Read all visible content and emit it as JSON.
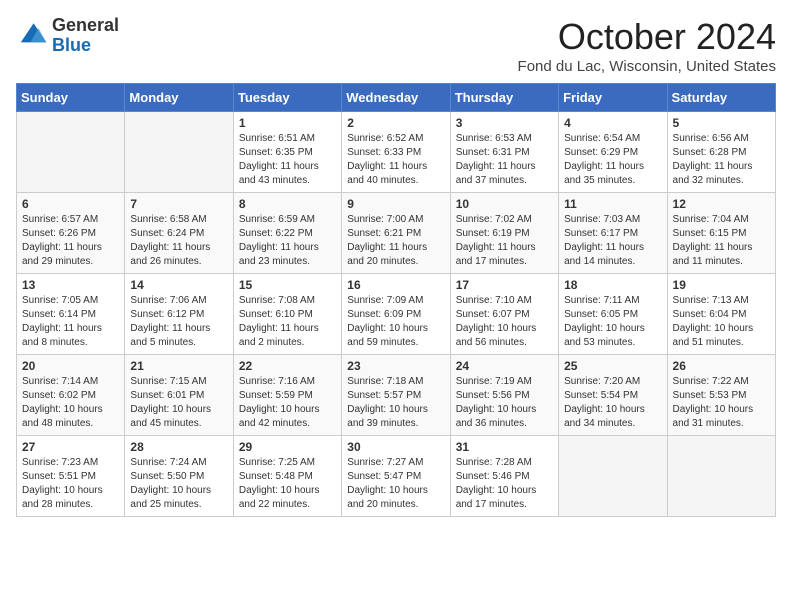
{
  "header": {
    "logo_line1": "General",
    "logo_line2": "Blue",
    "title": "October 2024",
    "subtitle": "Fond du Lac, Wisconsin, United States"
  },
  "columns": [
    "Sunday",
    "Monday",
    "Tuesday",
    "Wednesday",
    "Thursday",
    "Friday",
    "Saturday"
  ],
  "weeks": [
    [
      {
        "day": "",
        "info": ""
      },
      {
        "day": "",
        "info": ""
      },
      {
        "day": "1",
        "info": "Sunrise: 6:51 AM\nSunset: 6:35 PM\nDaylight: 11 hours\nand 43 minutes."
      },
      {
        "day": "2",
        "info": "Sunrise: 6:52 AM\nSunset: 6:33 PM\nDaylight: 11 hours\nand 40 minutes."
      },
      {
        "day": "3",
        "info": "Sunrise: 6:53 AM\nSunset: 6:31 PM\nDaylight: 11 hours\nand 37 minutes."
      },
      {
        "day": "4",
        "info": "Sunrise: 6:54 AM\nSunset: 6:29 PM\nDaylight: 11 hours\nand 35 minutes."
      },
      {
        "day": "5",
        "info": "Sunrise: 6:56 AM\nSunset: 6:28 PM\nDaylight: 11 hours\nand 32 minutes."
      }
    ],
    [
      {
        "day": "6",
        "info": "Sunrise: 6:57 AM\nSunset: 6:26 PM\nDaylight: 11 hours\nand 29 minutes."
      },
      {
        "day": "7",
        "info": "Sunrise: 6:58 AM\nSunset: 6:24 PM\nDaylight: 11 hours\nand 26 minutes."
      },
      {
        "day": "8",
        "info": "Sunrise: 6:59 AM\nSunset: 6:22 PM\nDaylight: 11 hours\nand 23 minutes."
      },
      {
        "day": "9",
        "info": "Sunrise: 7:00 AM\nSunset: 6:21 PM\nDaylight: 11 hours\nand 20 minutes."
      },
      {
        "day": "10",
        "info": "Sunrise: 7:02 AM\nSunset: 6:19 PM\nDaylight: 11 hours\nand 17 minutes."
      },
      {
        "day": "11",
        "info": "Sunrise: 7:03 AM\nSunset: 6:17 PM\nDaylight: 11 hours\nand 14 minutes."
      },
      {
        "day": "12",
        "info": "Sunrise: 7:04 AM\nSunset: 6:15 PM\nDaylight: 11 hours\nand 11 minutes."
      }
    ],
    [
      {
        "day": "13",
        "info": "Sunrise: 7:05 AM\nSunset: 6:14 PM\nDaylight: 11 hours\nand 8 minutes."
      },
      {
        "day": "14",
        "info": "Sunrise: 7:06 AM\nSunset: 6:12 PM\nDaylight: 11 hours\nand 5 minutes."
      },
      {
        "day": "15",
        "info": "Sunrise: 7:08 AM\nSunset: 6:10 PM\nDaylight: 11 hours\nand 2 minutes."
      },
      {
        "day": "16",
        "info": "Sunrise: 7:09 AM\nSunset: 6:09 PM\nDaylight: 10 hours\nand 59 minutes."
      },
      {
        "day": "17",
        "info": "Sunrise: 7:10 AM\nSunset: 6:07 PM\nDaylight: 10 hours\nand 56 minutes."
      },
      {
        "day": "18",
        "info": "Sunrise: 7:11 AM\nSunset: 6:05 PM\nDaylight: 10 hours\nand 53 minutes."
      },
      {
        "day": "19",
        "info": "Sunrise: 7:13 AM\nSunset: 6:04 PM\nDaylight: 10 hours\nand 51 minutes."
      }
    ],
    [
      {
        "day": "20",
        "info": "Sunrise: 7:14 AM\nSunset: 6:02 PM\nDaylight: 10 hours\nand 48 minutes."
      },
      {
        "day": "21",
        "info": "Sunrise: 7:15 AM\nSunset: 6:01 PM\nDaylight: 10 hours\nand 45 minutes."
      },
      {
        "day": "22",
        "info": "Sunrise: 7:16 AM\nSunset: 5:59 PM\nDaylight: 10 hours\nand 42 minutes."
      },
      {
        "day": "23",
        "info": "Sunrise: 7:18 AM\nSunset: 5:57 PM\nDaylight: 10 hours\nand 39 minutes."
      },
      {
        "day": "24",
        "info": "Sunrise: 7:19 AM\nSunset: 5:56 PM\nDaylight: 10 hours\nand 36 minutes."
      },
      {
        "day": "25",
        "info": "Sunrise: 7:20 AM\nSunset: 5:54 PM\nDaylight: 10 hours\nand 34 minutes."
      },
      {
        "day": "26",
        "info": "Sunrise: 7:22 AM\nSunset: 5:53 PM\nDaylight: 10 hours\nand 31 minutes."
      }
    ],
    [
      {
        "day": "27",
        "info": "Sunrise: 7:23 AM\nSunset: 5:51 PM\nDaylight: 10 hours\nand 28 minutes."
      },
      {
        "day": "28",
        "info": "Sunrise: 7:24 AM\nSunset: 5:50 PM\nDaylight: 10 hours\nand 25 minutes."
      },
      {
        "day": "29",
        "info": "Sunrise: 7:25 AM\nSunset: 5:48 PM\nDaylight: 10 hours\nand 22 minutes."
      },
      {
        "day": "30",
        "info": "Sunrise: 7:27 AM\nSunset: 5:47 PM\nDaylight: 10 hours\nand 20 minutes."
      },
      {
        "day": "31",
        "info": "Sunrise: 7:28 AM\nSunset: 5:46 PM\nDaylight: 10 hours\nand 17 minutes."
      },
      {
        "day": "",
        "info": ""
      },
      {
        "day": "",
        "info": ""
      }
    ]
  ]
}
